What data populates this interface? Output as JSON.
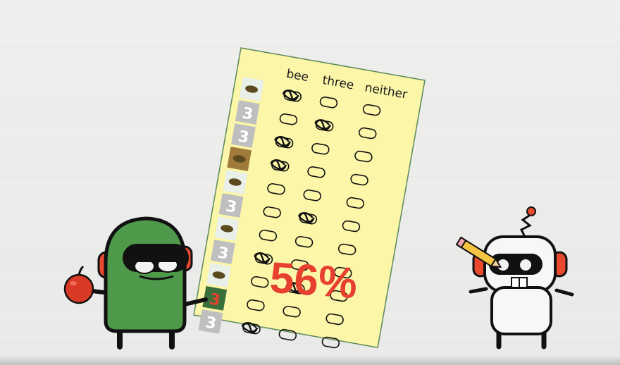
{
  "worksheet": {
    "columns": [
      "bee",
      "three",
      "neither"
    ],
    "rows": [
      {
        "picture": "bee-photo-tile-icon",
        "answer": 0
      },
      {
        "picture": "number-three-tile-icon",
        "answer": 1
      },
      {
        "picture": "number-three-tile-icon",
        "answer": 0
      },
      {
        "picture": "bee-photo-tile-icon",
        "answer": 0
      },
      {
        "picture": "bee-photo-tile-icon",
        "answer": null
      },
      {
        "picture": "number-three-tile-icon",
        "answer": 1
      },
      {
        "picture": "bee-photo-tile-icon",
        "answer": null
      },
      {
        "picture": "number-three-tile-icon",
        "answer": 0
      },
      {
        "picture": "bee-photo-tile-icon",
        "answer": 1
      },
      {
        "picture": "number-three-tile-icon",
        "answer": null
      },
      {
        "picture": "number-three-tile-icon",
        "answer": 0
      }
    ],
    "score": "56%"
  },
  "colors": {
    "paper": "#fbf6a8",
    "paper_border": "#5a8a5a",
    "score_red": "#e8402f",
    "teacher_robot_green": "#4e9a4a",
    "student_robot_white": "#f7f7f7",
    "ear_orange": "#e8492f",
    "apple_red": "#d93a26",
    "pencil_yellow": "#f4c542"
  },
  "characters": {
    "left": {
      "name": "teacher-robot",
      "holds": "apple-icon"
    },
    "right": {
      "name": "student-robot",
      "holds": "pencil-icon"
    }
  }
}
